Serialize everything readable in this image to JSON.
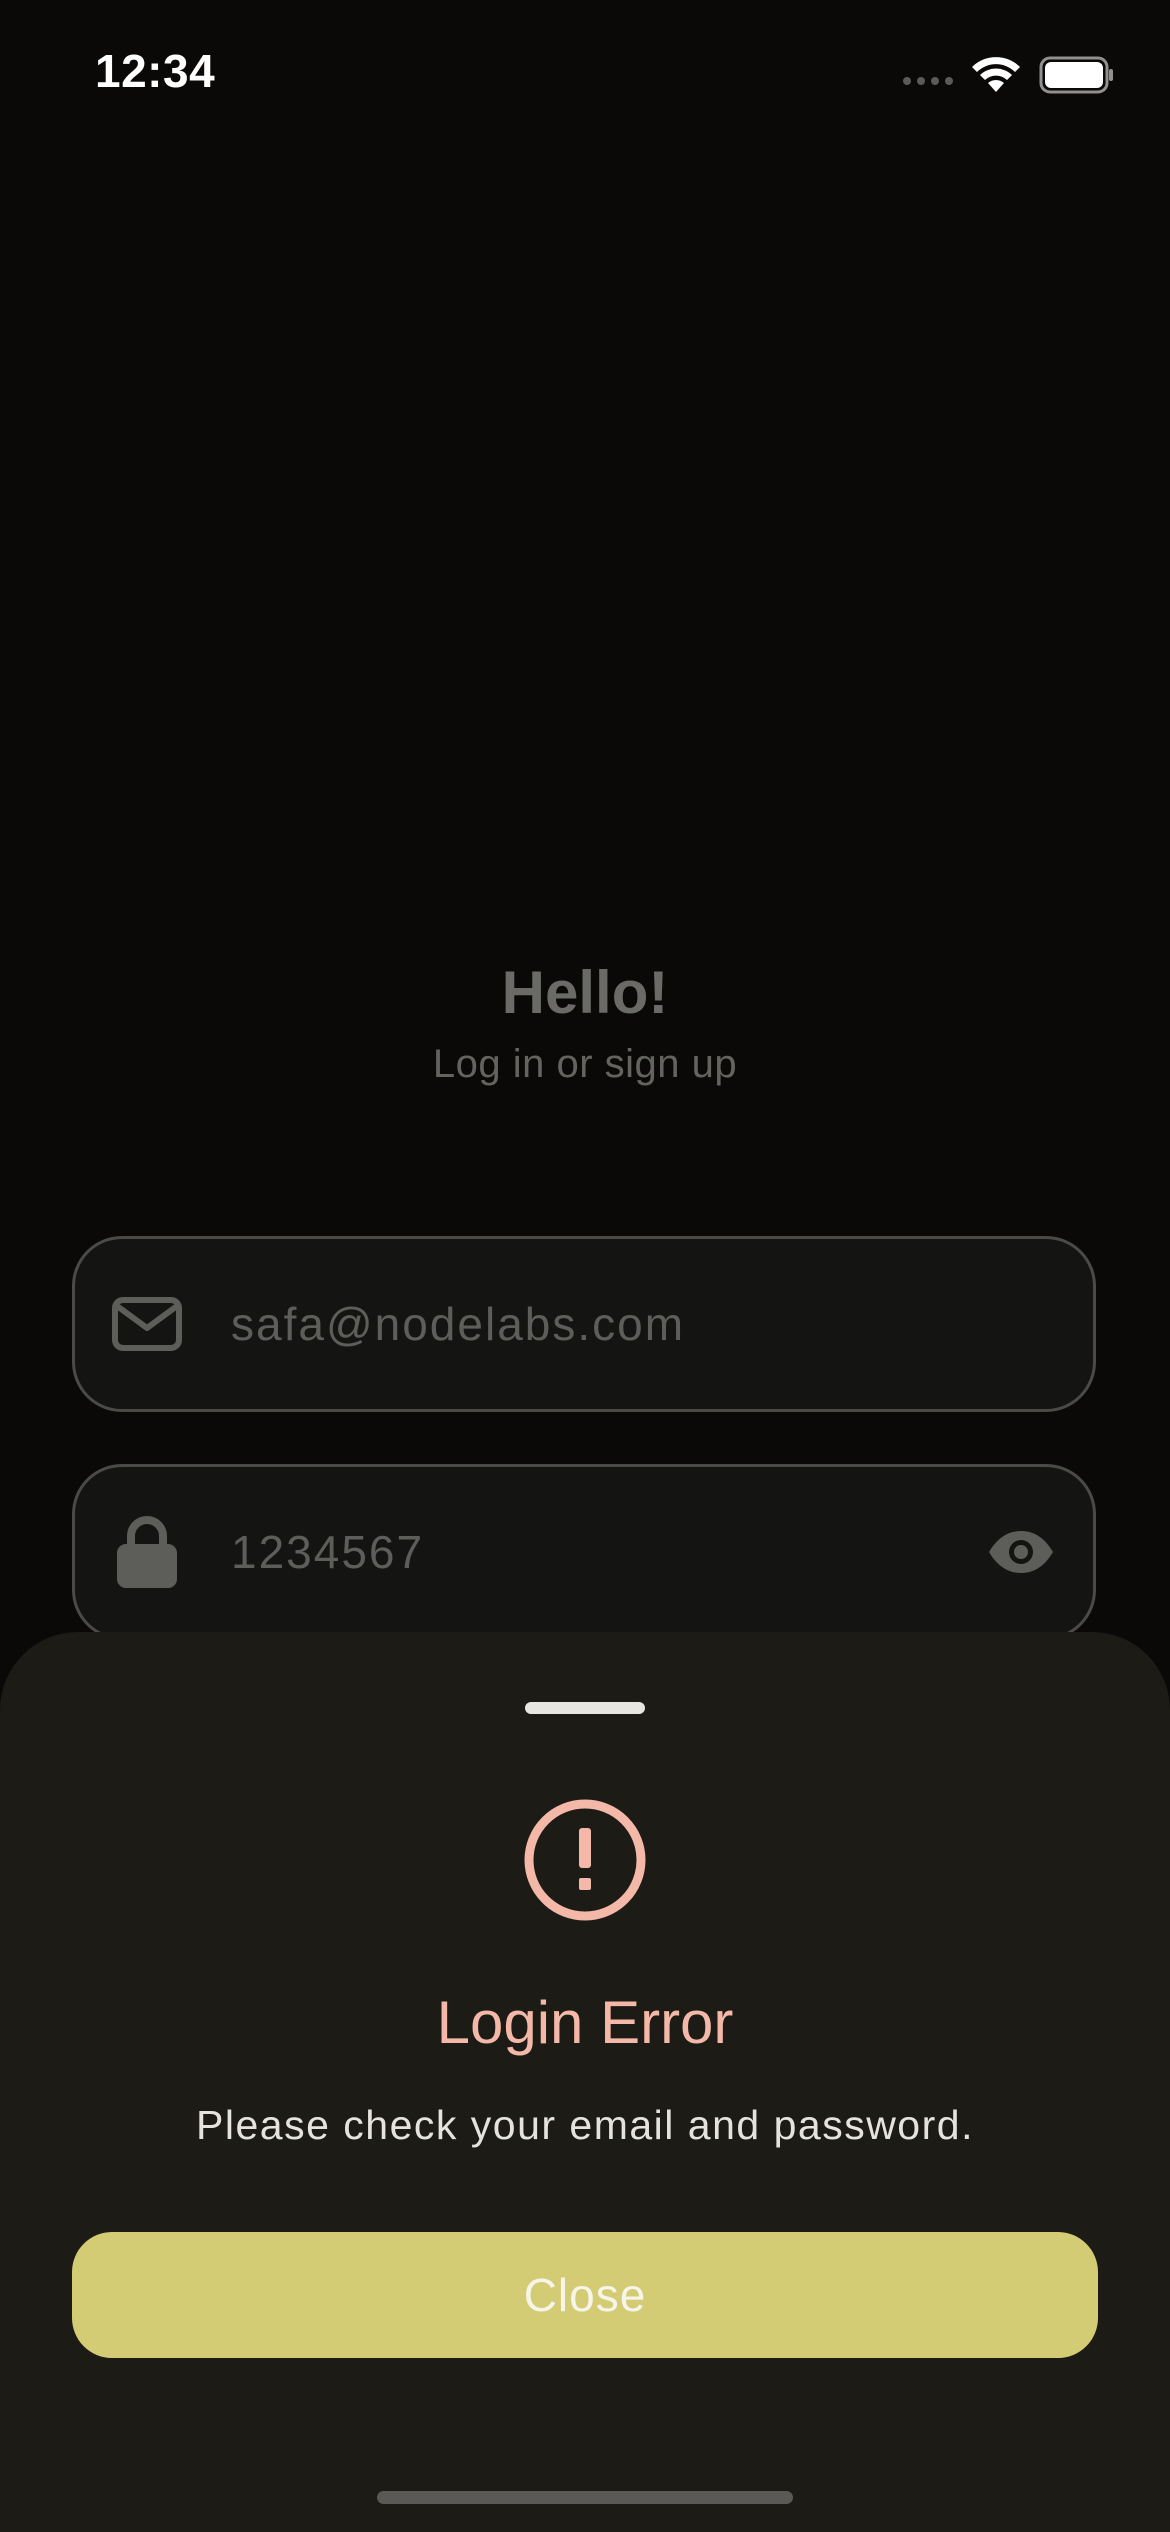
{
  "status_bar": {
    "time": "12:34"
  },
  "welcome": {
    "title": "Hello!",
    "subtitle": "Log in or sign up"
  },
  "form": {
    "email": {
      "value": "safa@nodelabs.com",
      "icon": "mail-icon"
    },
    "password": {
      "value": "1234567",
      "icon": "lock-icon",
      "toggle_icon": "eye-icon"
    }
  },
  "sheet": {
    "icon": "alert-circle-icon",
    "title": "Login Error",
    "message": "Please check your email and password.",
    "close_label": "Close"
  },
  "colors": {
    "background": "#0a0907",
    "sheet_background": "#1c1b16",
    "error": "#f3b8a8",
    "accent": "#d4cc74"
  }
}
